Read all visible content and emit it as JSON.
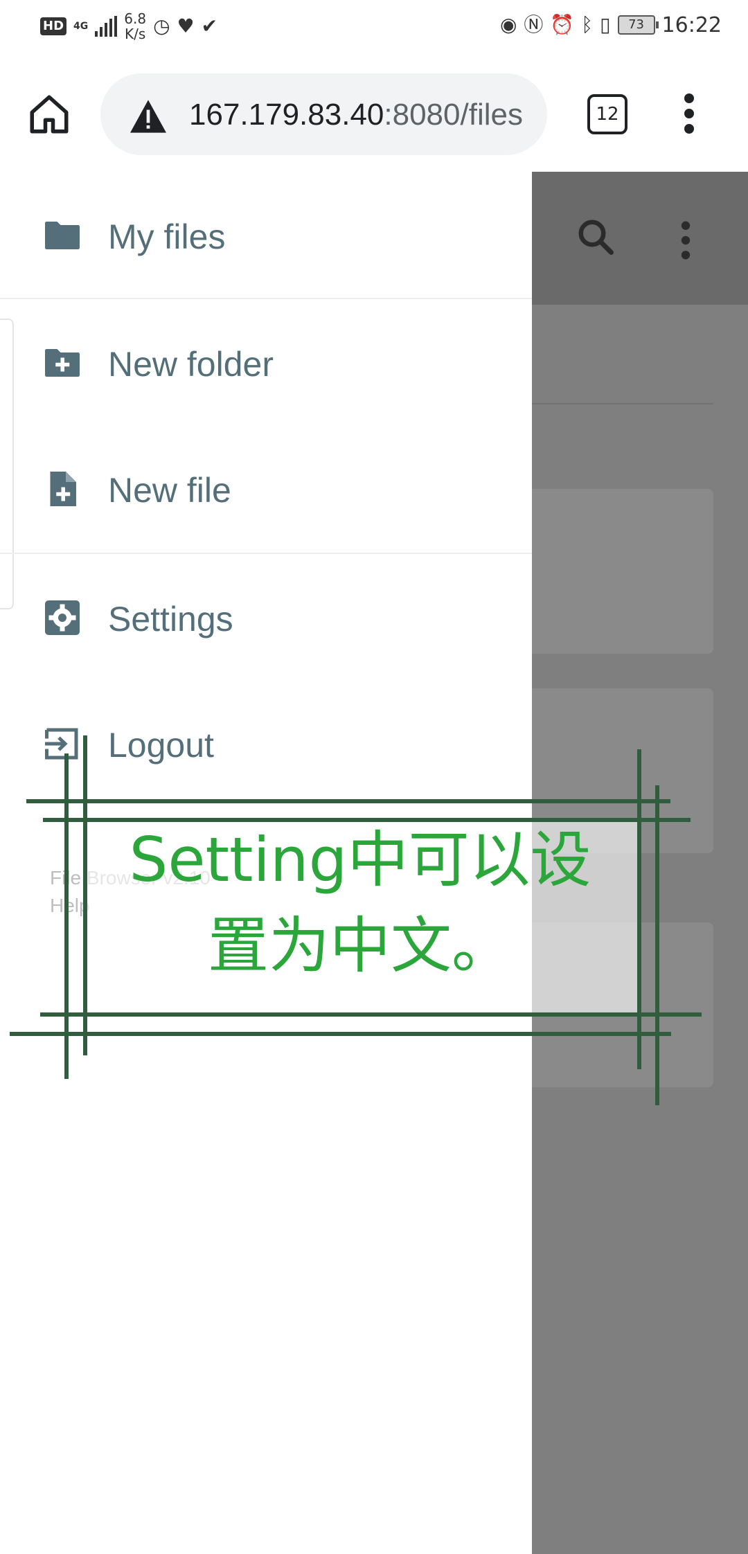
{
  "status_bar": {
    "hd": "HD",
    "network": "4G",
    "speed_value": "6.8",
    "speed_unit": "K/s",
    "battery": "73",
    "time": "16:22"
  },
  "browser": {
    "url_host": "167.179.83.40",
    "url_path": ":8080/files",
    "tab_count": "12"
  },
  "drawer": {
    "items": [
      {
        "label": "My files",
        "icon": "folder-icon"
      },
      {
        "label": "New folder",
        "icon": "folder-plus-icon"
      },
      {
        "label": "New file",
        "icon": "file-plus-icon"
      },
      {
        "label": "Settings",
        "icon": "gear-icon"
      },
      {
        "label": "Logout",
        "icon": "logout-icon"
      }
    ],
    "credits": {
      "line1": "File Browser v2.10",
      "line2": "Help"
    }
  },
  "overlay": {
    "line1": "Setting中可以设",
    "line2": "置为中文。",
    "color": "#2aa63a"
  },
  "colors": {
    "drawer_text": "#546e7a",
    "scrim": "#7f7f7f"
  }
}
